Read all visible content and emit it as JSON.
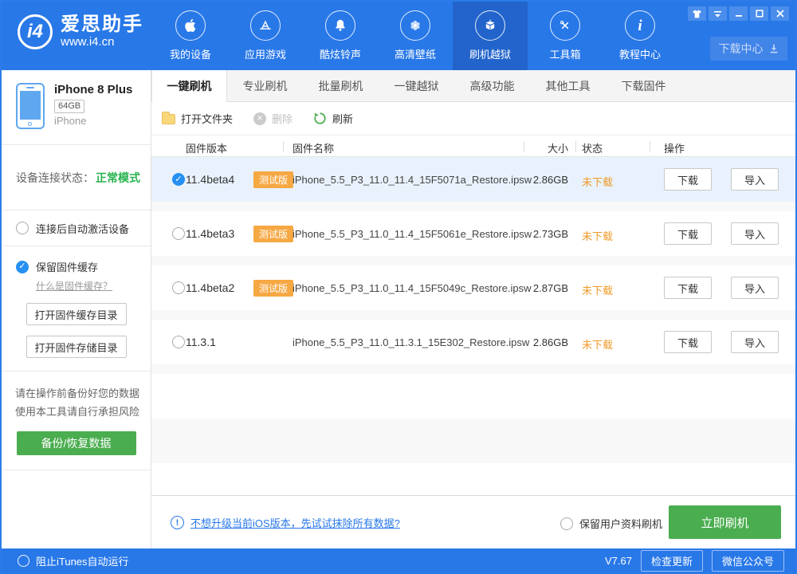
{
  "header": {
    "logo_mark": "i4",
    "logo_title": "爱思助手",
    "logo_url": "www.i4.cn",
    "nav": [
      {
        "label": "我的设备",
        "icon": "apple-icon",
        "active": false
      },
      {
        "label": "应用游戏",
        "icon": "appstore-icon",
        "active": false
      },
      {
        "label": "酷炫铃声",
        "icon": "bell-icon",
        "active": false
      },
      {
        "label": "高清壁纸",
        "icon": "flower-icon",
        "active": false
      },
      {
        "label": "刷机越狱",
        "icon": "jailbreak-box-icon",
        "active": true
      },
      {
        "label": "工具箱",
        "icon": "tools-icon",
        "active": false
      },
      {
        "label": "教程中心",
        "icon": "info-icon",
        "active": false
      }
    ],
    "download_center": "下载中心"
  },
  "sidebar": {
    "device": {
      "name": "iPhone 8 Plus",
      "capacity": "64GB",
      "model": "iPhone"
    },
    "status": {
      "label": "设备连接状态：",
      "value": "正常模式",
      "value_color": "#28b450"
    },
    "auto_activate": {
      "label": "连接后自动激活设备",
      "checked": false
    },
    "keep_cache": {
      "label": "保留固件缓存",
      "checked": true,
      "help": "什么是固件缓存？"
    },
    "open_cache_dir": "打开固件缓存目录",
    "open_store_dir": "打开固件存储目录",
    "warning_line1": "请在操作前备份好您的数据",
    "warning_line2": "使用本工具请自行承担风险",
    "backup_button": "备份/恢复数据"
  },
  "tabs": {
    "items": [
      "一键刷机",
      "专业刷机",
      "批量刷机",
      "一键越狱",
      "高级功能",
      "其他工具",
      "下载固件"
    ],
    "active_index": 0
  },
  "toolbar": {
    "open_folder": "打开文件夹",
    "delete": "删除",
    "refresh": "刷新"
  },
  "table": {
    "columns": {
      "version": "固件版本",
      "name": "固件名称",
      "size": "大小",
      "status": "状态",
      "action": "操作"
    },
    "download_label": "下载",
    "import_label": "导入",
    "rows": [
      {
        "version": "11.4beta4",
        "badge": "测试版",
        "file": "iPhone_5.5_P3_11.0_11.4_15F5071a_Restore.ipsw",
        "size": "2.86GB",
        "status": "未下载",
        "selected": true
      },
      {
        "version": "11.4beta3",
        "badge": "测试版",
        "file": "iPhone_5.5_P3_11.0_11.4_15F5061e_Restore.ipsw",
        "size": "2.73GB",
        "status": "未下载",
        "selected": false
      },
      {
        "version": "11.4beta2",
        "badge": "测试版",
        "file": "iPhone_5.5_P3_11.0_11.4_15F5049c_Restore.ipsw",
        "size": "2.87GB",
        "status": "未下载",
        "selected": false
      },
      {
        "version": "11.3.1",
        "badge": "",
        "file": "iPhone_5.5_P3_11.0_11.3.1_15E302_Restore.ipsw",
        "size": "2.86GB",
        "status": "未下载",
        "selected": false
      }
    ]
  },
  "flashbar": {
    "hint": "不想升级当前iOS版本，先试试抹除所有数据?",
    "keep_user_data": {
      "label": "保留用户资料刷机",
      "checked": false
    },
    "flash_now": "立即刷机"
  },
  "statusbar": {
    "block_itunes": {
      "label": "阻止iTunes自动运行",
      "checked": false
    },
    "version": "V7.67",
    "check_update": "检查更新",
    "wechat": "微信公众号"
  },
  "colors": {
    "header_blue": "#2878e8",
    "active_nav_blue": "#2264cb",
    "green": "#4aad4f",
    "status_green": "#28b450",
    "badge_orange": "#f6a843",
    "status_orange": "#f09a29",
    "selected_row_bg": "#e9f2fc",
    "link_blue": "#2878e8"
  }
}
